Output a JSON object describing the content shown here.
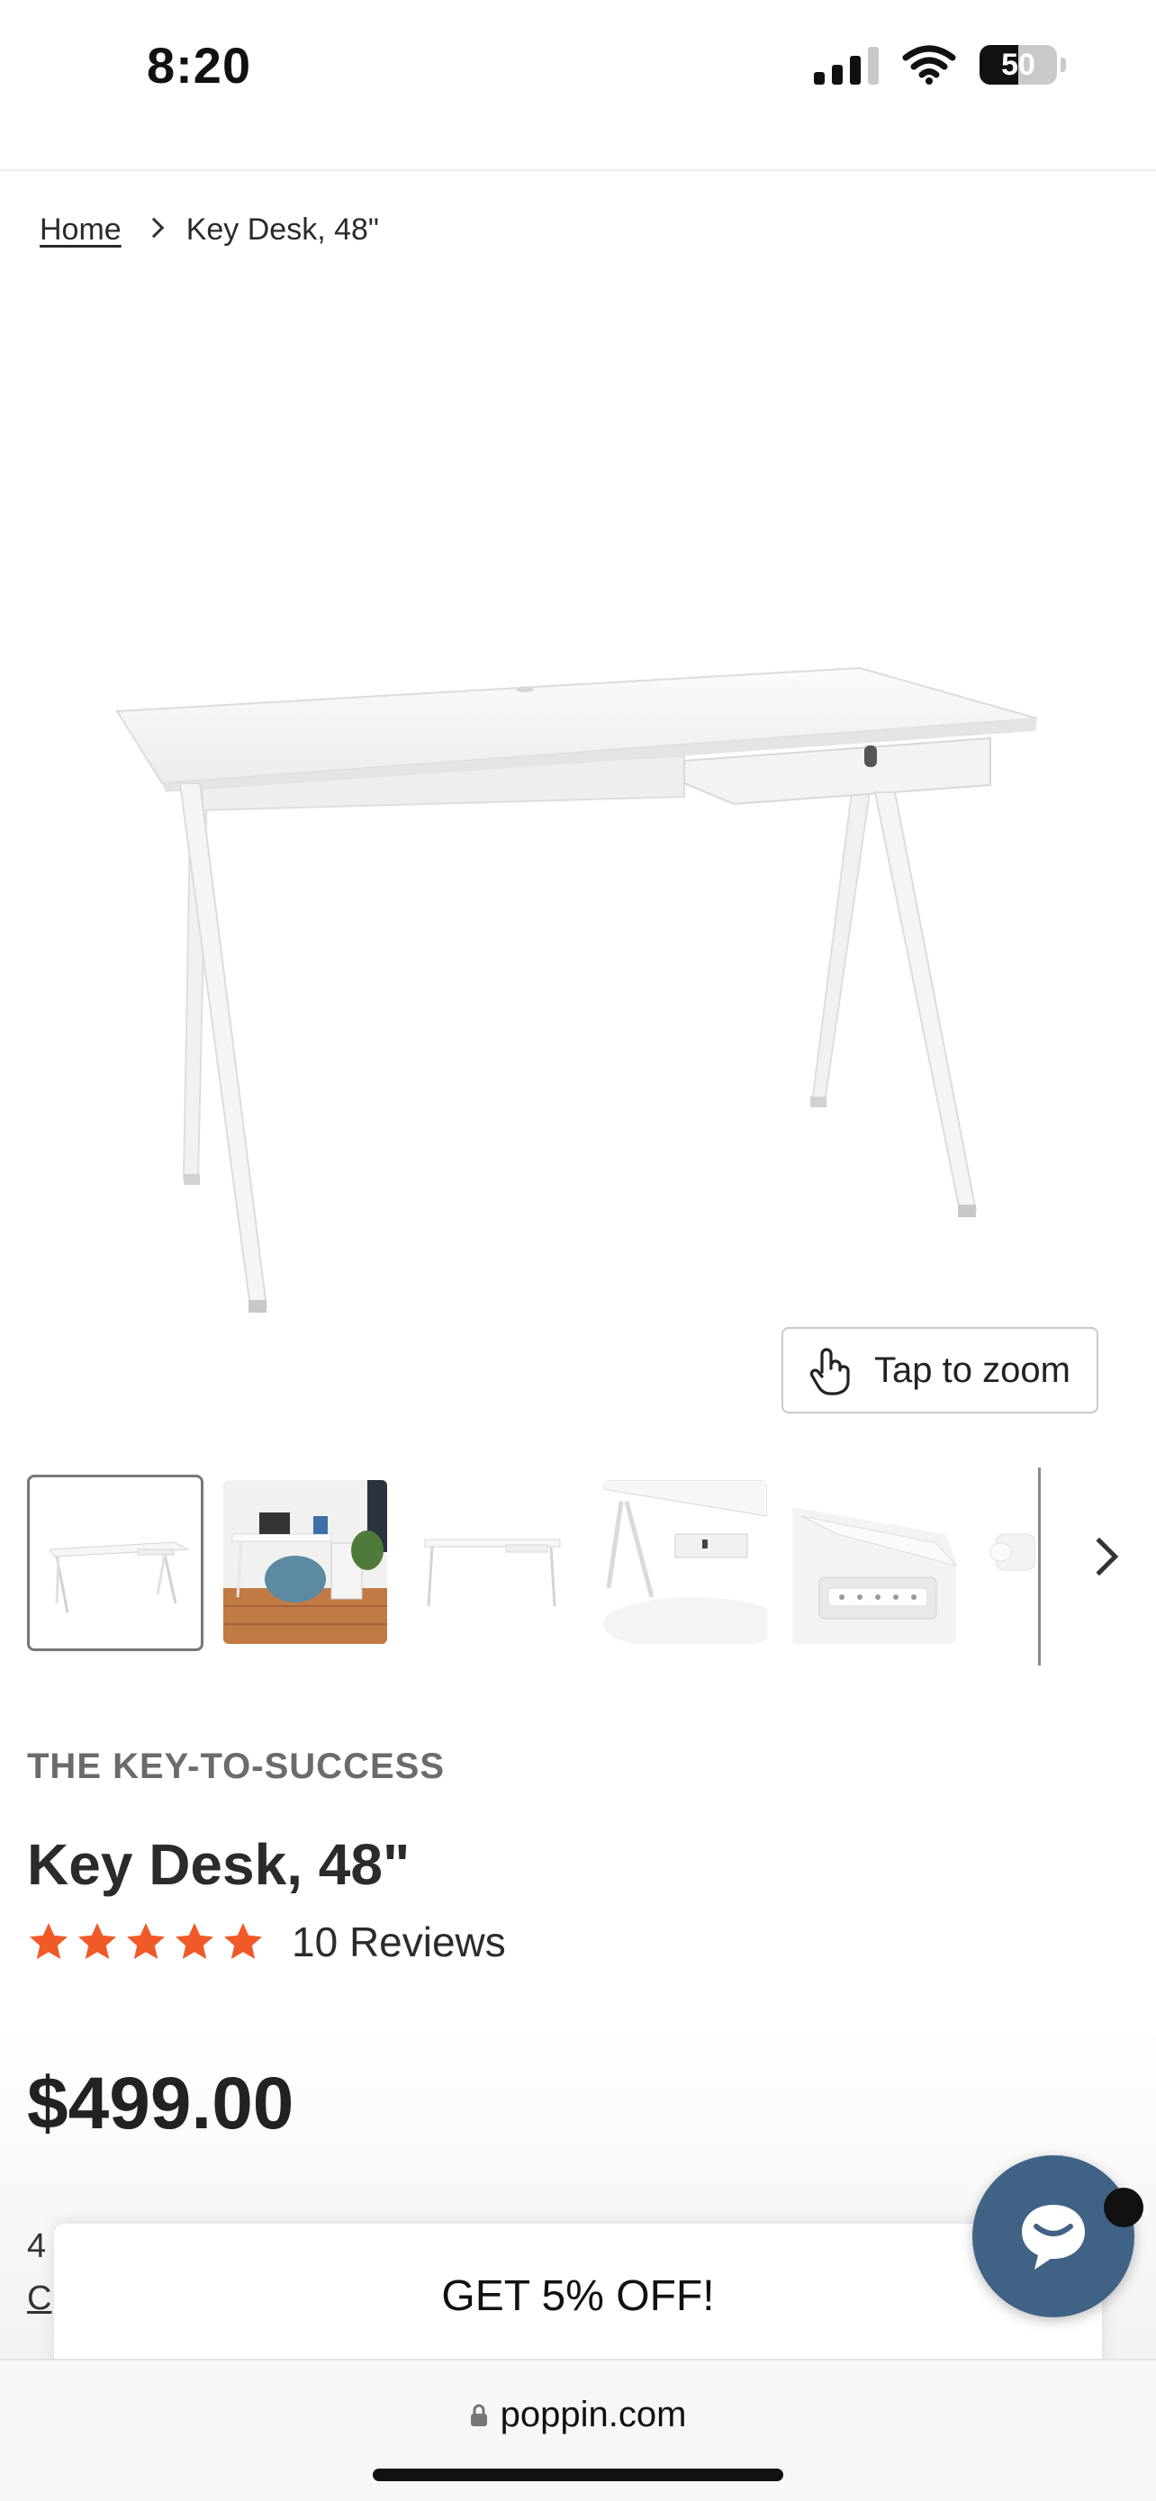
{
  "status_bar": {
    "time": "8:20",
    "battery": "50",
    "battery_level": 0.5,
    "icons": [
      "signal-icon",
      "wifi-icon",
      "battery-icon"
    ]
  },
  "breadcrumb": {
    "home": "Home",
    "current": "Key Desk, 48\""
  },
  "hero": {
    "zoom_label": "Tap to zoom",
    "icon": "tap-hand-icon"
  },
  "thumbnails": [
    {
      "name": "desk-front",
      "selected": true
    },
    {
      "name": "desk-office-scene",
      "selected": false
    },
    {
      "name": "desk-side",
      "selected": false
    },
    {
      "name": "desk-angle",
      "selected": false
    },
    {
      "name": "desk-cable-tray",
      "selected": false
    },
    {
      "name": "desk-detail",
      "selected": false
    }
  ],
  "product": {
    "collection": "THE KEY-TO-SUCCESS",
    "title": "Key Desk, 48\"",
    "rating": 5,
    "reviews": "10 Reviews",
    "price": "$499.00",
    "partial_line1": "4",
    "partial_line2": "C"
  },
  "promo": {
    "label": "GET 5% OFF!"
  },
  "browser": {
    "url": "poppin.com"
  },
  "colors": {
    "star": "#f05a28",
    "chat": "#3f6285",
    "text": "#2b2b2b",
    "muted": "#6b6b6b"
  }
}
